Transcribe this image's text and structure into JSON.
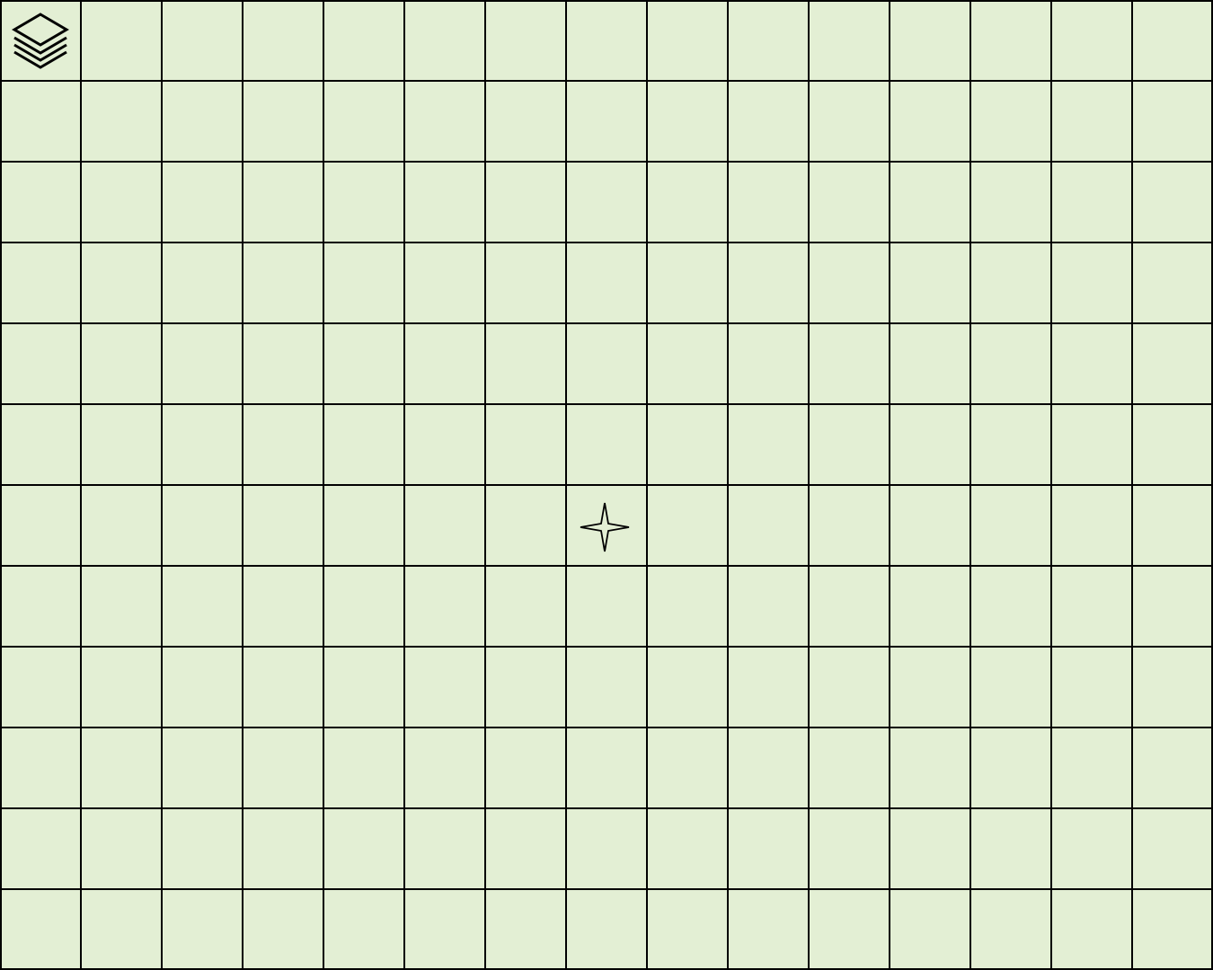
{
  "board": {
    "columns": 15,
    "rows": 12,
    "background_color": "#e3efd4",
    "grid_line_color": "#000000"
  },
  "toolbar": {
    "layers_icon": "layers-icon"
  },
  "markers": [
    {
      "icon": "four-point-star-icon",
      "column": 8,
      "row": 7
    }
  ]
}
